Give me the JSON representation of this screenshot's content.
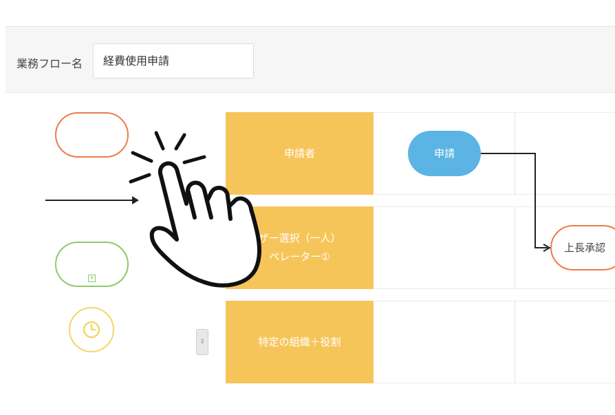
{
  "header": {
    "flow_name_label": "業務フロー名",
    "flow_name_value": "経費使用申請"
  },
  "lanes": [
    {
      "label_lines": [
        "申請者"
      ]
    },
    {
      "label_lines": [
        "ザー選択（一人）",
        "ペレーター①"
      ]
    },
    {
      "label_lines": [
        "特定の組織＋役割"
      ]
    }
  ],
  "nodes": {
    "apply": "申請",
    "approve": "上長承認"
  },
  "palette": {
    "start_shape": "start-node",
    "subprocess_shape": "subprocess-node",
    "timer_shape": "clock-icon"
  },
  "colors": {
    "lane_header": "#f6c55a",
    "apply_node": "#5bb4e3",
    "start_border": "#ee7a4a",
    "subprocess_border": "#8cc96a",
    "timer_border": "#f3d66a"
  }
}
